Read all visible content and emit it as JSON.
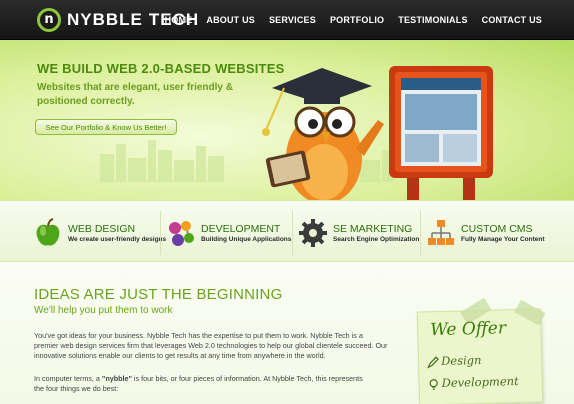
{
  "header": {
    "logo_word1": "NYBBLE",
    "logo_word2": "TECH",
    "nav": [
      "HOME",
      "ABOUT US",
      "SERVICES",
      "PORTFOLIO",
      "TESTIMONIALS",
      "CONTACT US"
    ]
  },
  "hero": {
    "title": "WE BUILD WEB 2.0-BASED WEBSITES",
    "subtitle": "Websites that are elegant, user friendly & positioned correctly.",
    "cta": "See Our Portfolio & Know Us Better!"
  },
  "services": [
    {
      "title": "WEB DESIGN",
      "desc": "We create user-friendly designs",
      "icon": "apple-icon"
    },
    {
      "title": "DEVELOPMENT",
      "desc": "Building Unique Applications",
      "icon": "molecule-icon"
    },
    {
      "title": "SE MARKETING",
      "desc": "Search Engine Optimization",
      "icon": "gear-icon"
    },
    {
      "title": "CUSTOM CMS",
      "desc": "Fully Manage Your Content",
      "icon": "sitemap-icon"
    }
  ],
  "main": {
    "heading": "IDEAS ARE JUST THE BEGINNING",
    "subheading": "We'll help you put them to work",
    "para1": "You've got ideas for your business. Nybble Tech has the expertise to put them to work. Nybble Tech is a premier web design services firm that leverages Web 2.0 technologies to help our global clientele succeed. Our innovative solutions enable our clients to get results at any time from anywhere in the world.",
    "para2_pre": "In computer terms, a ",
    "para2_bold": "\"nybble\"",
    "para2_post": " is four bits, or four pieces of information. At Nybble Tech, this represents the four things we do best:"
  },
  "offer": {
    "title": "We Offer",
    "items": [
      "Design",
      "Development"
    ]
  },
  "colors": {
    "accent_green": "#6aa41a",
    "header_bg": "#1b1b1b"
  }
}
